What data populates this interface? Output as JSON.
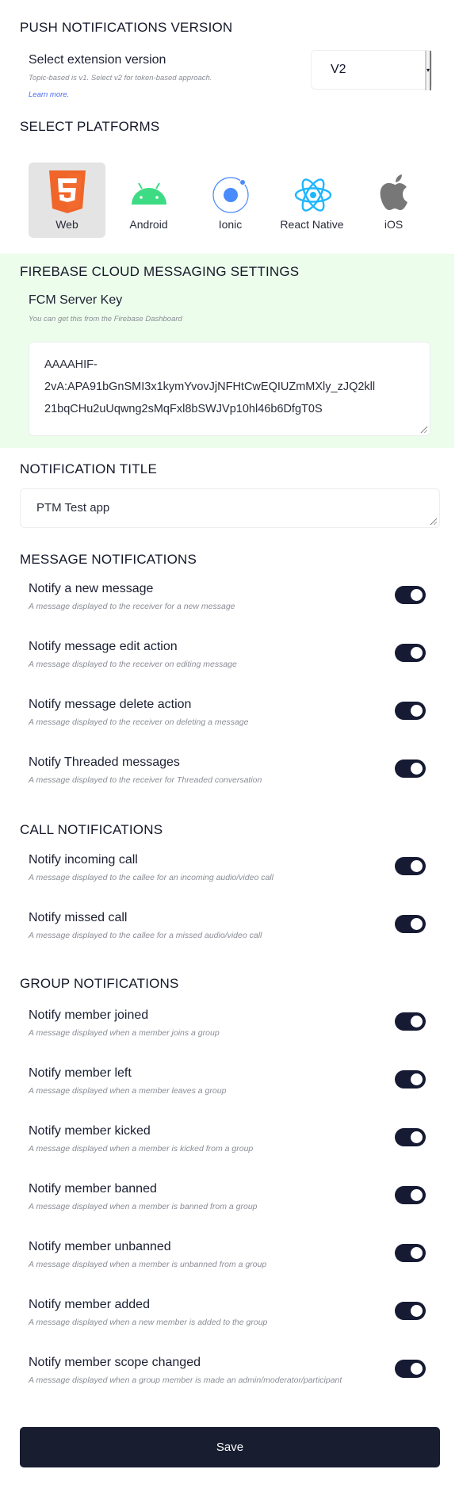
{
  "push_version": {
    "heading": "PUSH NOTIFICATIONS VERSION",
    "label": "Select extension version",
    "hint": "Topic-based is v1. Select v2 for token-based approach.",
    "learn_more": "Learn more.",
    "selected": "V2"
  },
  "platforms": {
    "heading": "SELECT PLATFORMS",
    "items": [
      {
        "label": "Web",
        "icon": "html5-icon",
        "selected": true
      },
      {
        "label": "Android",
        "icon": "android-icon",
        "selected": false
      },
      {
        "label": "Ionic",
        "icon": "ionic-icon",
        "selected": false
      },
      {
        "label": "React Native",
        "icon": "react-icon",
        "selected": false
      },
      {
        "label": "iOS",
        "icon": "apple-icon",
        "selected": false
      }
    ]
  },
  "fcm": {
    "heading": "FIREBASE CLOUD MESSAGING SETTINGS",
    "label": "FCM Server Key",
    "hint": "You can get this from the Firebase Dashboard",
    "value": "AAAAHIF-2vA:APA91bGnSMI3x1kymYvovJjNFHtCwEQIUZmMXly_zJQ2kll21bqCHu2uUqwng2sMqFxl8bSWJVp10hl46b6DfgT0S",
    "lines": [
      "AAAAHIF-",
      "2vA:APA91bGnSMI3x1kymYvovJjNFHtCwEQIUZmMXly_zJQ2kll",
      "21bqCHu2uUqwng2sMqFxl8bSWJVp10hl46b6DfgT0S"
    ]
  },
  "notification_title": {
    "heading": "NOTIFICATION TITLE",
    "value": "PTM Test app"
  },
  "message_notifications": {
    "heading": "MESSAGE NOTIFICATIONS",
    "items": [
      {
        "label": "Notify a new message",
        "hint": "A message displayed to the receiver for a new message",
        "on": true
      },
      {
        "label": "Notify message edit action",
        "hint": "A message displayed to the receiver on editing message",
        "on": true
      },
      {
        "label": "Notify message delete action",
        "hint": "A message displayed to the receiver on deleting a message",
        "on": true
      },
      {
        "label": "Notify Threaded messages",
        "hint": "A message displayed to the receiver for Threaded conversation",
        "on": true
      }
    ]
  },
  "call_notifications": {
    "heading": "CALL NOTIFICATIONS",
    "items": [
      {
        "label": "Notify incoming call",
        "hint": "A message displayed to the callee for an incoming audio/video call",
        "on": true
      },
      {
        "label": "Notify missed call",
        "hint": "A message displayed to the callee for a missed audio/video call",
        "on": true
      }
    ]
  },
  "group_notifications": {
    "heading": "GROUP NOTIFICATIONS",
    "items": [
      {
        "label": "Notify member joined",
        "hint": "A message displayed when a member joins a group",
        "on": true
      },
      {
        "label": "Notify member left",
        "hint": "A message displayed when a member leaves a group",
        "on": true
      },
      {
        "label": "Notify member kicked",
        "hint": "A message displayed when a member is kicked from a group",
        "on": true
      },
      {
        "label": "Notify member banned",
        "hint": "A message displayed when a member is banned from a group",
        "on": true
      },
      {
        "label": "Notify member unbanned",
        "hint": "A message displayed when a member is unbanned from a group",
        "on": true
      },
      {
        "label": "Notify member added",
        "hint": "A message displayed when a new member is added to the group",
        "on": true
      },
      {
        "label": "Notify member scope changed",
        "hint": "A message displayed when a group member is made an admin/moderator/participant",
        "on": true
      }
    ]
  },
  "save_label": "Save",
  "colors": {
    "toggle_on": "#161a33",
    "save_bg": "#181d30",
    "fcm_bg": "#ecfdeb",
    "link": "#4a6cf7"
  }
}
